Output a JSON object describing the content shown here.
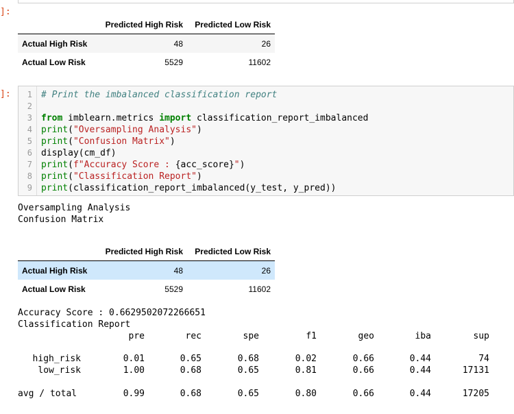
{
  "prompts": {
    "first": "]:",
    "second": "]:"
  },
  "table": {
    "columns": [
      "Predicted High Risk",
      "Predicted Low Risk"
    ],
    "rows": [
      {
        "label": "Actual High Risk",
        "values": [
          "48",
          "26"
        ]
      },
      {
        "label": "Actual Low Risk",
        "values": [
          "5529",
          "11602"
        ]
      }
    ]
  },
  "code": {
    "line_numbers": [
      "1",
      "2",
      "3",
      "4",
      "5",
      "6",
      "7",
      "8",
      "9"
    ],
    "comment": "# Print the imbalanced classification report",
    "l3_kw1": "from",
    "l3_mod": " imblearn.metrics ",
    "l3_kw2": "import",
    "l3_rest": " classification_report_imbalanced",
    "l4_fn": "print",
    "l4_open": "(",
    "l4_str": "\"Oversampling Analysis\"",
    "l4_close": ")",
    "l5_fn": "print",
    "l5_open": "(",
    "l5_str": "\"Confusion Matrix\"",
    "l5_close": ")",
    "l6": "display(cm_df)",
    "l7_fn": "print",
    "l7_open": "(",
    "l7_str": "f\"Accuracy Score : ",
    "l7_var": "{acc_score}",
    "l7_str2": "\"",
    "l7_close": ")",
    "l8_fn": "print",
    "l8_open": "(",
    "l8_str": "\"Classification Report\"",
    "l8_close": ")",
    "l9_fn": "print",
    "l9_rest": "(classification_report_imbalanced(y_test, y_pred))"
  },
  "output": {
    "line1": "Oversampling Analysis",
    "line2": "Confusion Matrix",
    "accuracy": "Accuracy Score : 0.6629502072266651",
    "report_title": "Classification Report",
    "report_headers": [
      "pre",
      "rec",
      "spe",
      "f1",
      "geo",
      "iba",
      "sup"
    ],
    "report_rows": [
      {
        "label": "high_risk",
        "values": [
          "0.01",
          "0.65",
          "0.68",
          "0.02",
          "0.66",
          "0.44",
          "74"
        ]
      },
      {
        "label": "low_risk",
        "values": [
          "1.00",
          "0.68",
          "0.65",
          "0.81",
          "0.66",
          "0.44",
          "17131"
        ]
      },
      {
        "label": "avg / total",
        "values": [
          "0.99",
          "0.68",
          "0.65",
          "0.80",
          "0.66",
          "0.44",
          "17205"
        ]
      }
    ]
  },
  "colors": {
    "highlight_row": "#cfe8fc",
    "prompt": "#d84315",
    "keyword": "#008000",
    "string": "#ba2121",
    "comment": "#408080"
  }
}
